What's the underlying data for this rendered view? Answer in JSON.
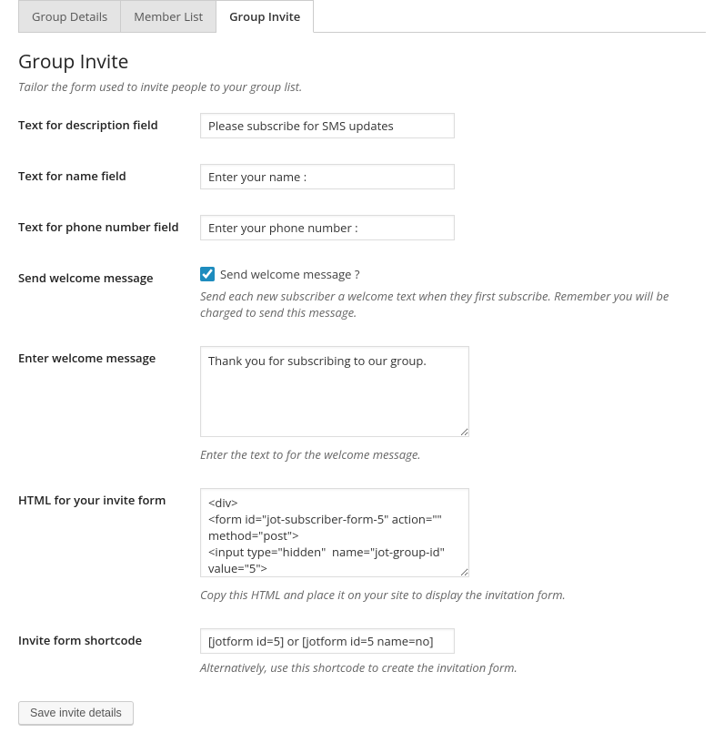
{
  "tabs": {
    "group_details": "Group Details",
    "member_list": "Member List",
    "group_invite": "Group Invite"
  },
  "section": {
    "title": "Group Invite",
    "description": "Tailor the form used to invite people to your group list."
  },
  "fields": {
    "desc_label": "Text for description field",
    "desc_value": "Please subscribe for SMS updates",
    "name_label": "Text for name field",
    "name_value": "Enter your name :",
    "phone_label": "Text for phone number field",
    "phone_value": "Enter your phone number :",
    "welcome_send_label": "Send welcome message",
    "welcome_send_checkbox_label": "Send welcome message ?",
    "welcome_send_checked": true,
    "welcome_send_help": "Send each new subscriber a welcome text when they first subscribe. Remember you will be charged to send this message.",
    "welcome_msg_label": "Enter welcome message",
    "welcome_msg_value": "Thank you for subscribing to our group.",
    "welcome_msg_help": "Enter the text to for the welcome message.",
    "html_label": "HTML for your invite form",
    "html_value": "<div>\n<form id=\"jot-subscriber-form-5\" action=\"\" method=\"post\">\n<input type=\"hidden\"  name=\"jot-group-id\" value=\"5\">\n<input type=\"hidden\"  name=\"jot_form_id\"",
    "html_help": "Copy this HTML and place it on your site to display the invitation form.",
    "shortcode_label": "Invite form shortcode",
    "shortcode_value": "[jotform id=5] or [jotform id=5 name=no]",
    "shortcode_help": "Alternatively, use this shortcode to create the invitation form."
  },
  "buttons": {
    "save": "Save invite details"
  }
}
